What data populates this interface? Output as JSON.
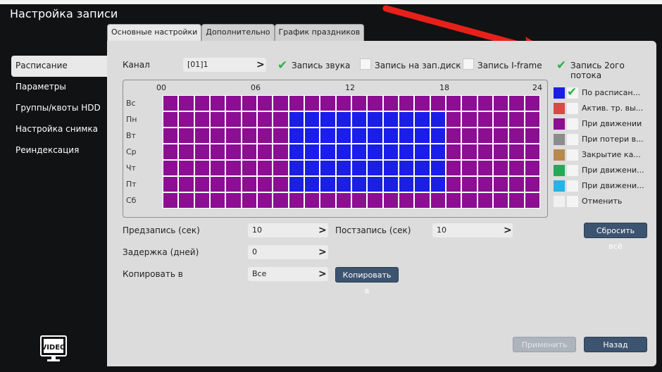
{
  "window": {
    "title": "Настройка записи"
  },
  "tabs": [
    {
      "label": "Основные настройки",
      "active": true
    },
    {
      "label": "Дополнительно",
      "active": false
    },
    {
      "label": "График праздников",
      "active": false
    }
  ],
  "sidebar": {
    "items": [
      {
        "label": "Расписание",
        "active": true
      },
      {
        "label": "Параметры",
        "active": false
      },
      {
        "label": "Группы/квоты HDD",
        "active": false
      },
      {
        "label": "Настройка снимка",
        "active": false
      },
      {
        "label": "Реиндексация",
        "active": false
      }
    ],
    "logo_text": "VIDEO"
  },
  "channel": {
    "label": "Канал",
    "value": "[01]1"
  },
  "options": {
    "audio": {
      "label": "Запись звука",
      "checked": true
    },
    "disk": {
      "label": "Запись на зап.диск",
      "checked": false
    },
    "iframe": {
      "label": "Запись I-frame",
      "checked": false
    },
    "second_stream": {
      "label": "Запись 2ого потока",
      "checked": true
    }
  },
  "schedule": {
    "hour_labels": [
      "00",
      "06",
      "12",
      "18",
      "24"
    ],
    "days": [
      "Вс",
      "Пн",
      "Вт",
      "Ср",
      "Чт",
      "Пт",
      "Сб"
    ],
    "colors": {
      "schedule": "#8b0e93",
      "motion": "#1a1ee6",
      "grid_lines": "#ffffff"
    },
    "motion_block": {
      "days": [
        "Пн",
        "Вт",
        "Ср",
        "Чт",
        "Пт"
      ],
      "hour_start": 8,
      "hour_end": 18
    }
  },
  "legend": [
    {
      "label": "По расписан...",
      "color": "#1a1ee6",
      "checked": true
    },
    {
      "label": "Актив. тр. вы...",
      "color": "#d84b45",
      "checked": false
    },
    {
      "label": "При движении",
      "color": "#8b0e93",
      "checked": false
    },
    {
      "label": "При потери в...",
      "color": "#8c8c8c",
      "checked": false
    },
    {
      "label": "Закрытие ка...",
      "color": "#b88a4e",
      "checked": false
    },
    {
      "label": "При движени...",
      "color": "#27a855",
      "checked": false
    },
    {
      "label": "При движени...",
      "color": "#27b3e6",
      "checked": false
    },
    {
      "label": "Отменить",
      "color": "#f0f0f0",
      "checked": false
    }
  ],
  "prerecord": {
    "label": "Предзапись (сек)",
    "value": "10"
  },
  "postrecord": {
    "label": "Постзапись (сек)",
    "value": "10"
  },
  "delay": {
    "label": "Задержка (дней)",
    "value": "0"
  },
  "copy": {
    "label": "Копировать в",
    "value": "Все",
    "button": "Копировать в"
  },
  "buttons": {
    "reset_all": "Сбросить всё",
    "apply": "Применить",
    "back": "Назад"
  }
}
